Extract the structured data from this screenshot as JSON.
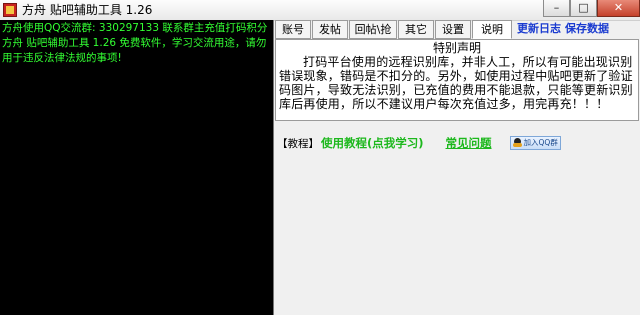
{
  "window": {
    "title": "方舟 贴吧辅助工具 1.26",
    "minimize": "–",
    "maximize": "□",
    "close": "✕",
    "icon": "app-logo-icon"
  },
  "console": {
    "lines": [
      "方舟使用QQ交流群: 330297133 联系群主充值打码积分",
      "方舟 贴吧辅助工具 1.26 免费软件，学习交流用途，请勿用于违反法律法规的事项!"
    ],
    "text_color": "#33ff33"
  },
  "tabs": [
    {
      "label": "账号"
    },
    {
      "label": "发帖"
    },
    {
      "label": "回帖\\抢楼"
    },
    {
      "label": "其它"
    },
    {
      "label": "设置"
    },
    {
      "label": "说明",
      "active": true
    }
  ],
  "links": {
    "changelog": "更新日志",
    "save": "保存数据"
  },
  "notice": {
    "title": "特别声明",
    "body": "打码平台使用的远程识别库，并非人工，所以有可能出现识别错误现象，错码是不扣分的。另外，如使用过程中贴吧更新了验证码图片，导致无法识别，已充值的费用不能退款，只能等更新识别库后再使用，所以不建议用户每次充值过多，用完再充！！！"
  },
  "tutorial": {
    "label": "【教程】",
    "link": "使用教程(点我学习)",
    "faq": "常见问题",
    "qq_button": "加入QQ群"
  },
  "colors": {
    "accent_green": "#1db81d",
    "link_blue": "#1a3bd0",
    "console_bg": "#000000"
  }
}
